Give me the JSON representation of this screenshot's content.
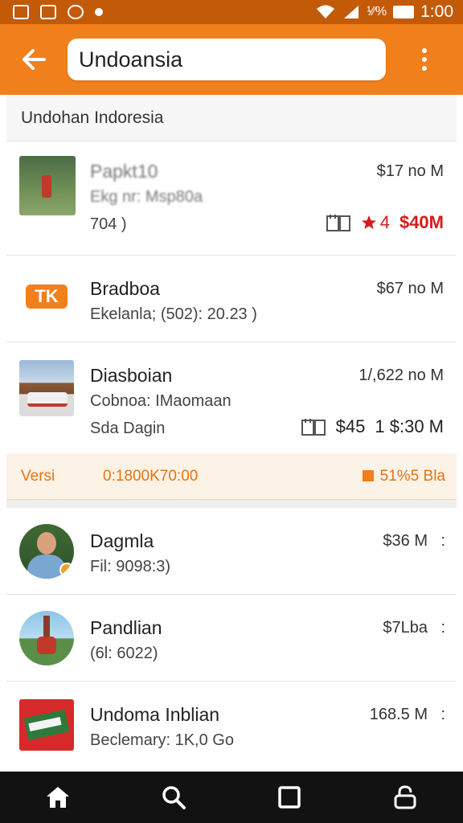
{
  "status": {
    "battery_pct": "¹⁄⁄%",
    "time": "1:00"
  },
  "search": {
    "value": "Undoansia"
  },
  "section": {
    "title": "Undohan Indoresia"
  },
  "listings": [
    {
      "title": "Papkt10",
      "subtitle": "Ekg nr: Msp80a",
      "line3": "704 )",
      "price": "$17 no M",
      "rating": "4",
      "amount": "$40M"
    },
    {
      "title": "Bradboa",
      "subtitle": "Ekelanla; (502): 20.23 )",
      "price": "$67 no M",
      "logo_text": "TK"
    },
    {
      "title": "Diasboian",
      "subtitle": "Cobnoa: IMaomaan",
      "line3": "Sda Dagin",
      "price": "1/,622 no M",
      "amount": "$45",
      "amount2": "1 $:30 M"
    }
  ],
  "banner": {
    "left": "Versi",
    "mid": "0:1800K70:00",
    "right": "51%5 Bla"
  },
  "people": [
    {
      "name": "Dagmla",
      "detail": "Fil: 9098:3)",
      "price": "$36 M",
      "more": ":"
    },
    {
      "name": "Pandlian",
      "detail": "(6l: 6022)",
      "price": "$7Lba",
      "more": ":"
    },
    {
      "name": "Undoma Inblian",
      "detail": "Beclemary: 1K,0 Go",
      "price": "168.5 M",
      "more": ":"
    }
  ],
  "colors": {
    "primary": "#f07f1c",
    "status_bar": "#c25a08",
    "accent_red": "#d21d1d",
    "nav_bar": "#121212"
  },
  "icons": [
    "image-icon",
    "document-icon",
    "settings-icon",
    "dot-icon",
    "wifi-icon",
    "signal-icon",
    "battery-icon",
    "back-arrow-icon",
    "more-vert-icon",
    "calendar-icon",
    "star-icon",
    "home-icon",
    "search-icon",
    "square-icon",
    "lock-icon"
  ]
}
